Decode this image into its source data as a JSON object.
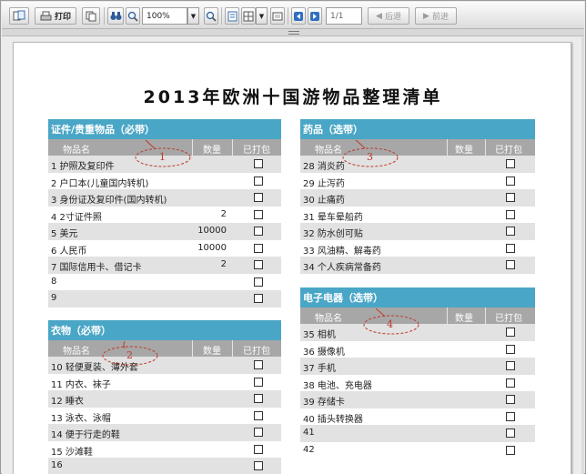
{
  "toolbar": {
    "print_label": "打印",
    "zoom_value": "100%",
    "page_value": "1/1",
    "prev_label": "后退",
    "next_label": "前进"
  },
  "document": {
    "title": "2013年欧洲十国游物品整理清单"
  },
  "columns": {
    "item": "物品名",
    "qty": "数量",
    "packed": "已打包"
  },
  "sections": {
    "documents": {
      "title": "证件/贵重物品（必带）",
      "rows": [
        {
          "item": "1  护照及复印件",
          "qty": ""
        },
        {
          "item": "2  户口本(儿童国内转机)",
          "qty": ""
        },
        {
          "item": "3  身份证及复印件(国内转机)",
          "qty": ""
        },
        {
          "item": "4  2寸证件照",
          "qty": "2"
        },
        {
          "item": "5  美元",
          "qty": "10000"
        },
        {
          "item": "6  人民币",
          "qty": "10000"
        },
        {
          "item": "7  国际信用卡、借记卡",
          "qty": "2"
        },
        {
          "item": "8",
          "qty": ""
        },
        {
          "item": "9",
          "qty": ""
        }
      ]
    },
    "clothing": {
      "title": "衣物（必带）",
      "rows": [
        {
          "item": "10 轻便夏装、薄外套",
          "qty": ""
        },
        {
          "item": "11 内衣、袜子",
          "qty": ""
        },
        {
          "item": "12 睡衣",
          "qty": ""
        },
        {
          "item": "13 泳衣、泳帽",
          "qty": ""
        },
        {
          "item": "14 便于行走的鞋",
          "qty": ""
        },
        {
          "item": "15 沙滩鞋",
          "qty": ""
        },
        {
          "item": "16",
          "qty": ""
        }
      ]
    },
    "medicine": {
      "title": "药品（选带）",
      "rows": [
        {
          "item": "28 消炎药",
          "qty": ""
        },
        {
          "item": "29 止泻药",
          "qty": ""
        },
        {
          "item": "30 止痛药",
          "qty": ""
        },
        {
          "item": "31 晕车晕船药",
          "qty": ""
        },
        {
          "item": "32 防水创可贴",
          "qty": ""
        },
        {
          "item": "33 风油精、解毒药",
          "qty": ""
        },
        {
          "item": "34 个人疾病常备药",
          "qty": ""
        }
      ]
    },
    "electronics": {
      "title": "电子电器（选带）",
      "rows": [
        {
          "item": "35 相机",
          "qty": ""
        },
        {
          "item": "36 摄像机",
          "qty": ""
        },
        {
          "item": "37 手机",
          "qty": ""
        },
        {
          "item": "38 电池、充电器",
          "qty": ""
        },
        {
          "item": "39 存储卡",
          "qty": ""
        },
        {
          "item": "40 插头转换器",
          "qty": ""
        },
        {
          "item": "41",
          "qty": ""
        },
        {
          "item": "42",
          "qty": ""
        }
      ]
    }
  },
  "annotations": [
    "1",
    "2",
    "3",
    "4"
  ],
  "colors": {
    "section_header": "#4aa6c6",
    "column_header": "#a7a7a7",
    "row_stripe": "#e2e2e2",
    "annotation": "#c0392b"
  }
}
